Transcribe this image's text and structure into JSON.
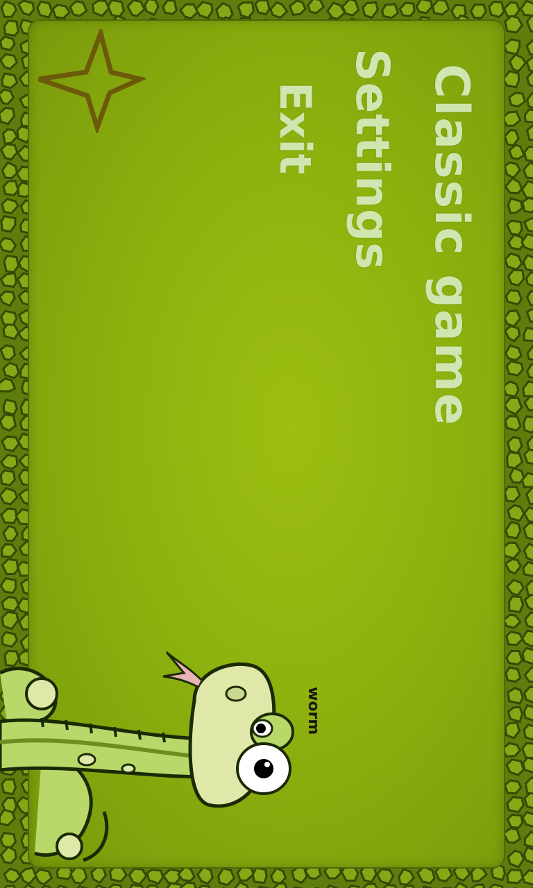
{
  "menu": {
    "items": [
      {
        "label": "Classic game"
      },
      {
        "label": "Settings"
      },
      {
        "label": "Exit"
      }
    ]
  },
  "brand": {
    "worm_label": "worm"
  },
  "icons": {
    "favorite": "star-icon",
    "mascot": "snake-mascot"
  },
  "colors": {
    "background_green": "#8db10e",
    "frame_green": "#5f7d0c",
    "menu_text": "#cfe6b0",
    "star_outline": "#6b5a0a"
  }
}
